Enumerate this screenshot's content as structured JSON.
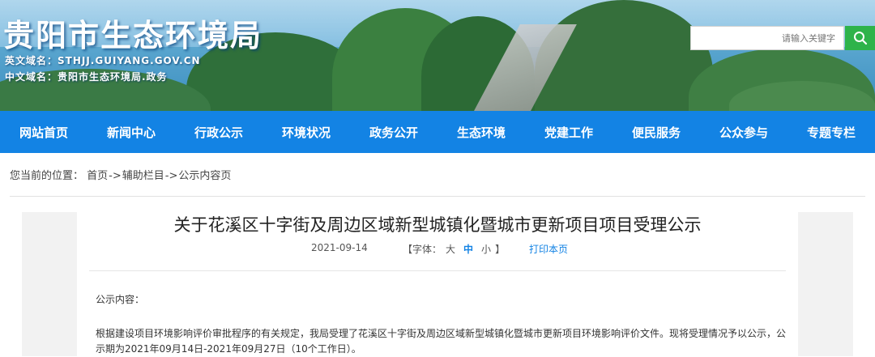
{
  "header": {
    "site_title": "贵阳市生态环境局",
    "domain_en": "英文域名：STHJJ.GUIYANG.GOV.CN",
    "domain_cn": "中文域名：贵阳市生态环境局.政务",
    "search_placeholder": "请输入关键字",
    "search_icon": "search-icon"
  },
  "nav": {
    "items": [
      "网站首页",
      "新闻中心",
      "行政公示",
      "环境状况",
      "政务公开",
      "生态环境",
      "党建工作",
      "便民服务",
      "公众参与",
      "专题专栏"
    ]
  },
  "breadcrumb": {
    "prefix": "您当前的位置：",
    "items": [
      "首页",
      "辅助栏目",
      "公示内容页"
    ],
    "separator": "->"
  },
  "article": {
    "title": "关于花溪区十字街及周边区域新型城镇化暨城市更新项目项目受理公示",
    "date": "2021-09-14",
    "font_label": "【字体：",
    "font_large": "大",
    "font_medium": "中",
    "font_small": "小",
    "font_close": "】",
    "print": "打印本页",
    "content_label": "公示内容：",
    "body": "根据建设项目环境影响评价审批程序的有关规定，我局受理了花溪区十字街及周边区域新型城镇化暨城市更新项目环境影响评价文件。现将受理情况予以公示，公示期为2021年09月14日-2021年09月27日（10个工作日）。"
  },
  "colors": {
    "nav_bg": "#1383e4",
    "search_button": "#2eb34a",
    "active_font": "#1383e4"
  }
}
